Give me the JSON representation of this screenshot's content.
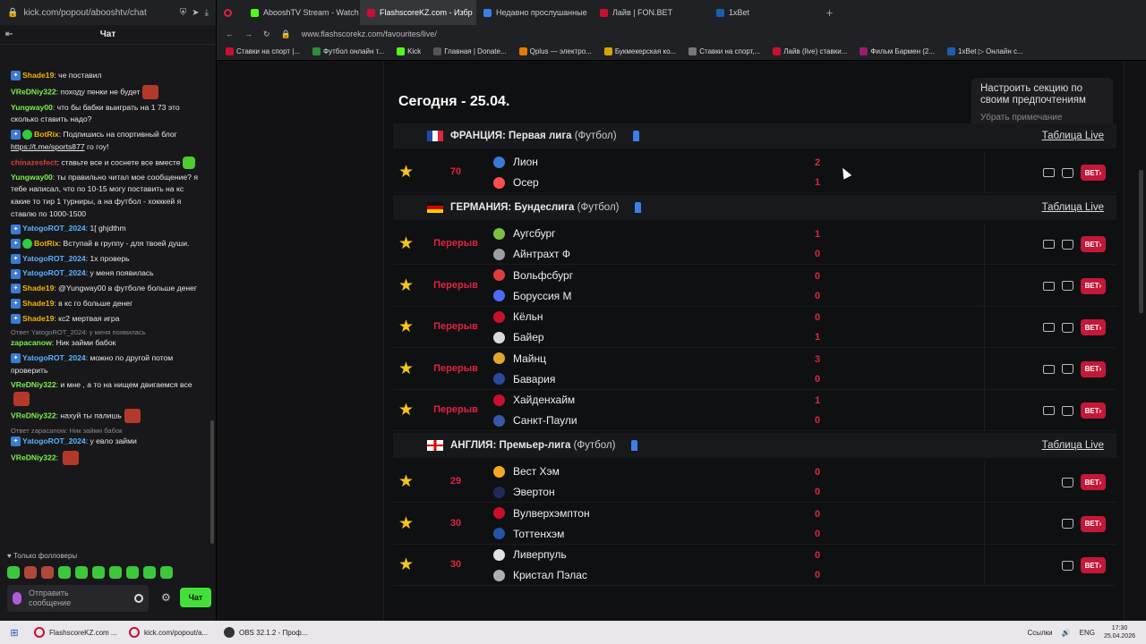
{
  "left_panel": {
    "url": "kick.com/popout/abooshtv/chat",
    "chat_title": "Чат",
    "messages": [
      {
        "user": "Shade19",
        "color": "#f4b400",
        "badge": true,
        "text": "че поставил"
      },
      {
        "user": "VReDNiy322",
        "color": "#7cf04a",
        "badge": false,
        "text": "походу пенки не будет",
        "emote": true
      },
      {
        "user": "Yungway00",
        "color": "#7cf04a",
        "badge": false,
        "text": "что бы бабки выиграть на 1 73 это сколько ставить надо?"
      },
      {
        "user": "BotRix",
        "color": "#f4b400",
        "badge": true,
        "verified": true,
        "text": "Подпишись на спортивный блог",
        "link": "https://t.me/sports877",
        "tail": "го гоу!"
      },
      {
        "user": "chinazesfect",
        "color": "#e03c3c",
        "badge": false,
        "text": "ставьте все и соснете все вместе",
        "emote_green": true
      },
      {
        "user": "Yungway00",
        "color": "#7cf04a",
        "badge": false,
        "text": "ты правильно читал мое сообщение? я тебе написал, что по 10-15 могу поставить на кс какие то тир 1 турниры, а на футбол - хокккей я ставлю по 1000-1500"
      },
      {
        "user": "YatogoROT_2024",
        "color": "#5ab3ff",
        "badge": true,
        "text": "1[ ghjdthm"
      },
      {
        "user": "BotRix",
        "color": "#f4b400",
        "badge": true,
        "verified": true,
        "text": "Вступай в группу - для твоей души."
      },
      {
        "user": "YatogoROT_2024",
        "color": "#5ab3ff",
        "badge": true,
        "text": "1х проверь"
      },
      {
        "user": "YatogoROT_2024",
        "color": "#5ab3ff",
        "badge": true,
        "text": "у меня появилась"
      },
      {
        "user": "Shade19",
        "color": "#f4b400",
        "badge": true,
        "text": "@Yungway00 в футболе больше денег"
      },
      {
        "user": "Shade19",
        "color": "#f4b400",
        "badge": true,
        "text": "в кс го больше денег"
      },
      {
        "user": "Shade19",
        "color": "#f4b400",
        "badge": true,
        "text": "кс2 мертвая игра"
      },
      {
        "reply": "Ответ YatogoROT_2024: у меня появилась",
        "user": "zapacanow",
        "color": "#7cf04a",
        "badge": false,
        "text": "Ник займи бабок"
      },
      {
        "user": "YatogoROT_2024",
        "color": "#5ab3ff",
        "badge": true,
        "text": "можно по другой потом проверить"
      },
      {
        "user": "VReDNiy322",
        "color": "#7cf04a",
        "badge": false,
        "text": "и мне , а то на нищем двигаемся все",
        "emote": true
      },
      {
        "user": "VReDNiy322",
        "color": "#7cf04a",
        "badge": false,
        "text": "нахуй ты палишь",
        "emote": true
      },
      {
        "reply": "Ответ zapacanow: Ник займи бабок",
        "user": "YatogoROT_2024",
        "color": "#5ab3ff",
        "badge": true,
        "text": "у евло займи"
      },
      {
        "user": "VReDNiy322",
        "color": "#7cf04a",
        "badge": false,
        "text": "",
        "emote": true
      }
    ],
    "followers_only": "Только фолловеры",
    "input_placeholder": "Отправить сообщение",
    "send_button": "Чат"
  },
  "browser": {
    "tabs": [
      {
        "label": "AbooshTV Stream - Watch",
        "color": "#53fc18",
        "active": false
      },
      {
        "label": "FlashscoreKZ.com - Избр",
        "color": "#c8102e",
        "active": true
      },
      {
        "label": "Недавно прослушанные",
        "color": "#3d7ee8",
        "active": false
      },
      {
        "label": "Лайв | FON.BET",
        "color": "#c8102e",
        "active": false
      },
      {
        "label": "1xBet",
        "color": "#1b5fae",
        "active": false
      }
    ],
    "url": "www.flashscorekz.com/favourites/live/",
    "bookmarks": [
      "Ставки на спорт |...",
      "Футбол онлайн т...",
      "Kick",
      "Главная | Donate...",
      "Qplus — электро...",
      "Букмекерская ко...",
      "Ставки на спорт,...",
      "Лайв (live) ставки...",
      "Фильм Бармен (2...",
      "1xBet ▷ Онлайн с..."
    ]
  },
  "page": {
    "date_heading": "Сегодня - 25.04.",
    "tooltip": {
      "title": "Настроить секцию по своим предпочтениям",
      "dismiss": "Убрать примечание"
    },
    "table_link": "Таблица Live",
    "bet_label": "BET›",
    "leagues": [
      {
        "country": "ФРАНЦИЯ: Первая лига",
        "sport": "(Футбол)",
        "flag": "fr",
        "matches": [
          {
            "status": "70",
            "home": "Лион",
            "away": "Осер",
            "hs": "2",
            "as": "1",
            "tv": true
          }
        ]
      },
      {
        "country": "ГЕРМАНИЯ: Бундеслига",
        "sport": "(Футбол)",
        "flag": "de",
        "matches": [
          {
            "status": "Перерыв",
            "home": "Аугсбург",
            "away": "Айнтрахт Ф",
            "hs": "1",
            "as": "0",
            "tv": true
          },
          {
            "status": "Перерыв",
            "home": "Вольфсбург",
            "away": "Боруссия М",
            "hs": "0",
            "as": "0",
            "tv": true
          },
          {
            "status": "Перерыв",
            "home": "Кёльн",
            "away": "Байер",
            "hs": "0",
            "as": "1",
            "tv": true
          },
          {
            "status": "Перерыв",
            "home": "Майнц",
            "away": "Бавария",
            "hs": "3",
            "as": "0",
            "tv": true
          },
          {
            "status": "Перерыв",
            "home": "Хайденхайм",
            "away": "Санкт-Паули",
            "hs": "1",
            "as": "0",
            "tv": true
          }
        ]
      },
      {
        "country": "АНГЛИЯ: Премьер-лига",
        "sport": "(Футбол)",
        "flag": "en",
        "matches": [
          {
            "status": "29",
            "home": "Вест Хэм",
            "away": "Эвертон",
            "hs": "0",
            "as": "0",
            "tv": false
          },
          {
            "status": "30",
            "home": "Вулверхэмптон",
            "away": "Тоттенхэм",
            "hs": "0",
            "as": "0",
            "tv": false
          },
          {
            "status": "30",
            "home": "Ливерпуль",
            "away": "Кристал Пэлас",
            "hs": "0",
            "as": "0",
            "tv": false
          }
        ]
      }
    ]
  },
  "taskbar": {
    "items": [
      "FlashscoreKZ.com ...",
      "kick.com/popout/a...",
      "OBS 32.1.2 - Проф..."
    ],
    "lang": "ENG",
    "links": "Ссылки",
    "time": "17:30",
    "date": "25.04.2026"
  }
}
